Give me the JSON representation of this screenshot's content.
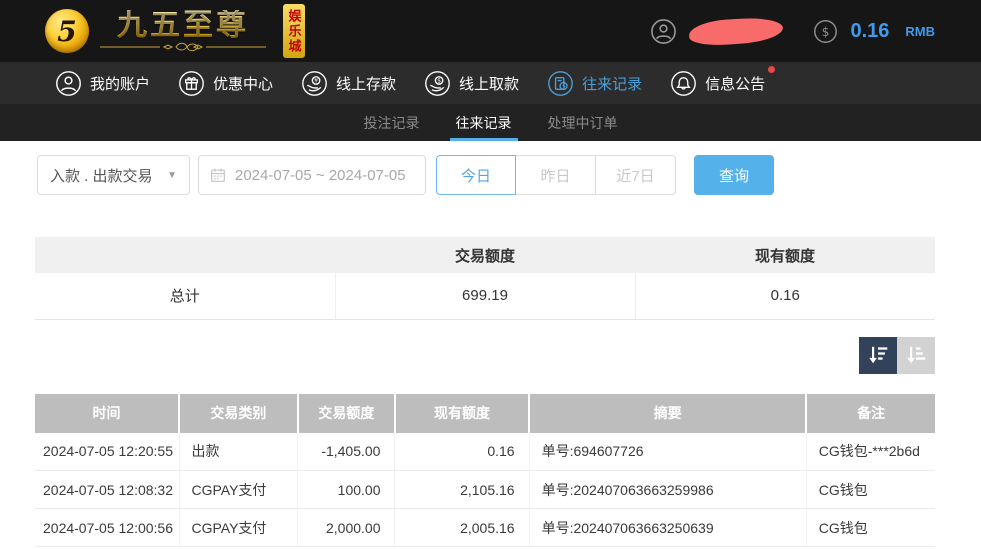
{
  "header": {
    "logo": {
      "monogram": "5",
      "title": "九五至尊",
      "badge": "娱乐城"
    },
    "user": {
      "balance": "0.16",
      "currency": "RMB"
    }
  },
  "nav": {
    "items": [
      {
        "label": "我的账户",
        "icon": "user-icon",
        "active": false
      },
      {
        "label": "优惠中心",
        "icon": "gift-icon",
        "active": false
      },
      {
        "label": "线上存款",
        "icon": "deposit-icon",
        "active": false
      },
      {
        "label": "线上取款",
        "icon": "withdraw-icon",
        "active": false
      },
      {
        "label": "往来记录",
        "icon": "records-icon",
        "active": true
      },
      {
        "label": "信息公告",
        "icon": "bell-icon",
        "active": false,
        "has_red_dot": true
      }
    ]
  },
  "subtabs": {
    "items": [
      {
        "label": "投注记录",
        "active": false
      },
      {
        "label": "往来记录",
        "active": true
      },
      {
        "label": "处理中订单",
        "active": false
      }
    ]
  },
  "filters": {
    "type_select_value": "入款 . 出款交易",
    "date_range_value": "2024-07-05 ~ 2024-07-05",
    "quick_buttons": [
      "今日",
      "昨日",
      "近7日"
    ],
    "active_quick_button": "今日",
    "search_label": "查询"
  },
  "summary": {
    "headers": [
      "",
      "交易额度",
      "现有额度"
    ],
    "row": {
      "label": "总计",
      "trade_amount": "699.19",
      "current_amount": "0.16"
    }
  },
  "table": {
    "headers": [
      "时间",
      "交易类别",
      "交易额度",
      "现有额度",
      "摘要",
      "备注"
    ],
    "rows": [
      [
        "2024-07-05 12:20:55",
        "出款",
        "-1,405.00",
        "0.16",
        "单号:694607726",
        "CG钱包-***2b6d"
      ],
      [
        "2024-07-05 12:08:32",
        "CGPAY支付",
        "100.00",
        "2,105.16",
        "单号:202407063663259986",
        "CG钱包"
      ],
      [
        "2024-07-05 12:00:56",
        "CGPAY支付",
        "2,000.00",
        "2,005.16",
        "单号:202407063663250639",
        "CG钱包"
      ]
    ]
  },
  "colors": {
    "accent_blue": "#54aee8",
    "nav_active_blue": "#4a9fd8",
    "balance_blue": "#3f9bf0",
    "notification_red": "#e8484d",
    "redaction_pink": "#f96a6a",
    "brand_gold": "#ffd95e",
    "sort_dark": "#31425a",
    "table_header_gray": "#bdbdbd"
  }
}
